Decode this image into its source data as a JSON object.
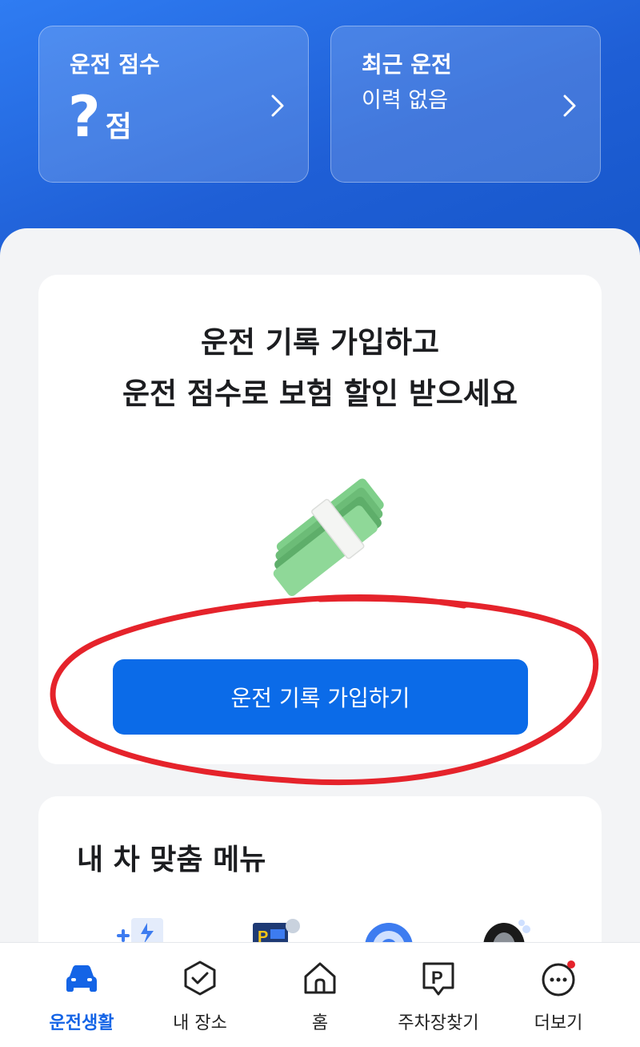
{
  "header": {
    "score_card": {
      "title": "운전 점수",
      "value": "?",
      "unit": "점"
    },
    "recent_card": {
      "title": "최근 운전",
      "subtitle": "이력 없음"
    }
  },
  "promo": {
    "line1": "운전 기록 가입하고",
    "line2": "운전 점수로 보험 할인 받으세요",
    "button_label": "운전 기록 가입하기"
  },
  "menu": {
    "title": "내 차 맞춤 메뉴",
    "items": [
      "ev-charge-icon",
      "parking-ticket-icon",
      "target-icon",
      "tire-icon"
    ]
  },
  "tabbar": {
    "tabs": [
      {
        "label": "운전생활",
        "icon": "car-icon",
        "active": true
      },
      {
        "label": "내 장소",
        "icon": "check-shield-icon",
        "active": false
      },
      {
        "label": "홈",
        "icon": "home-icon",
        "active": false
      },
      {
        "label": "주차장찾기",
        "icon": "parking-icon",
        "active": false
      },
      {
        "label": "더보기",
        "icon": "more-icon",
        "active": false,
        "badge": true
      }
    ]
  },
  "colors": {
    "accent": "#0b6be8",
    "header_blue": "#1f5fd6",
    "annotation_red": "#e5232b"
  }
}
